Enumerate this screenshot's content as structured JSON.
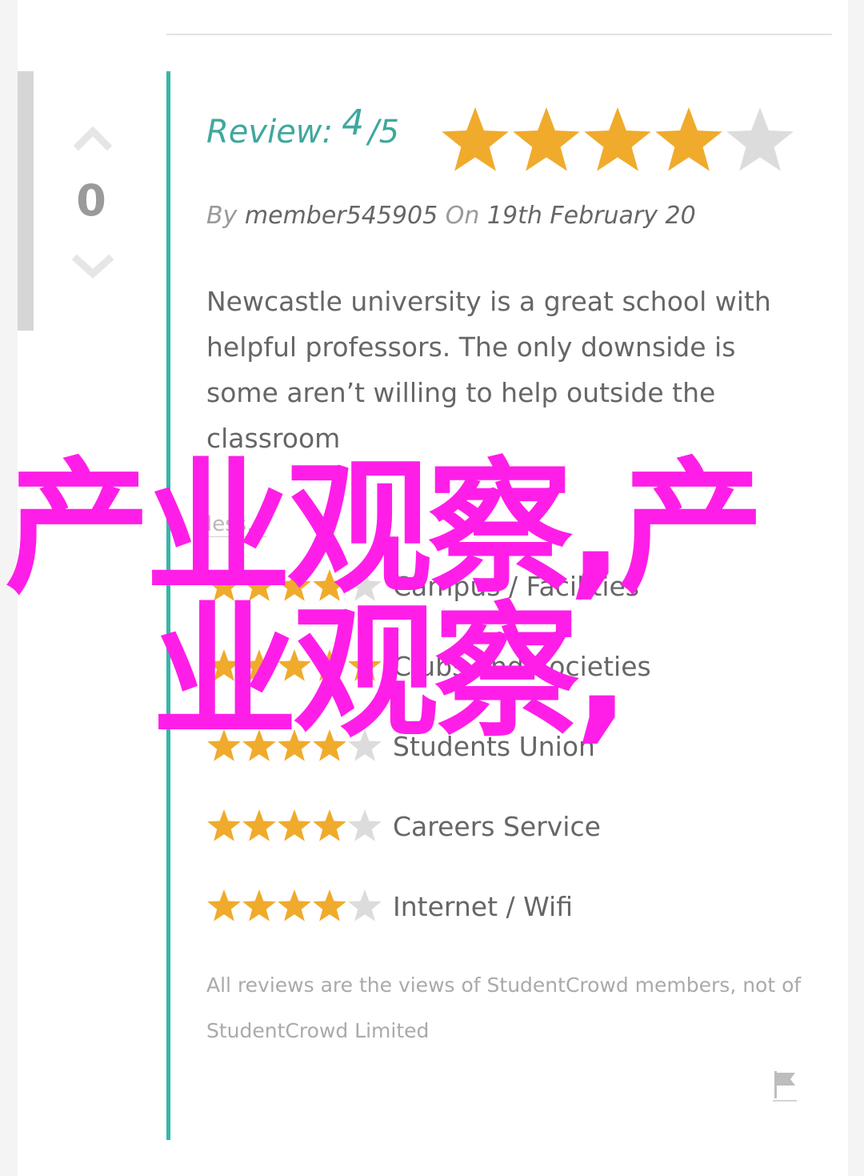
{
  "colors": {
    "accent": "#37b6a8",
    "star_filled": "#f0ab2c",
    "star_empty": "#dcdcdc",
    "overlay_text": "#ff1ee8"
  },
  "vote": {
    "count": "0",
    "up_icon": "chevron-up-icon",
    "down_icon": "chevron-down-icon"
  },
  "review": {
    "label": "Review:",
    "score": "4",
    "out_of": "/5",
    "rating": 4,
    "max": 5,
    "by_label": "By",
    "author": "member545905",
    "on_label": "On",
    "date": "19th February 20",
    "body": "Newcastle university is a great school with helpful professors. The only downside is some aren’t willing to help outside the classroom",
    "less_link": "less..."
  },
  "categories": [
    {
      "label": "Campus / Facilities",
      "rating": 4
    },
    {
      "label": "Clubs and Societies",
      "rating": 5
    },
    {
      "label": "Students Union",
      "rating": 4
    },
    {
      "label": "Careers Service",
      "rating": 4
    },
    {
      "label": "Internet / Wifi",
      "rating": 4
    }
  ],
  "disclaimer": "All reviews are the views of StudentCrowd members, not of StudentCrowd Limited",
  "flag_icon": "flag-icon",
  "overlay": {
    "line1": "产业观察,产",
    "line2": "业观察,"
  }
}
